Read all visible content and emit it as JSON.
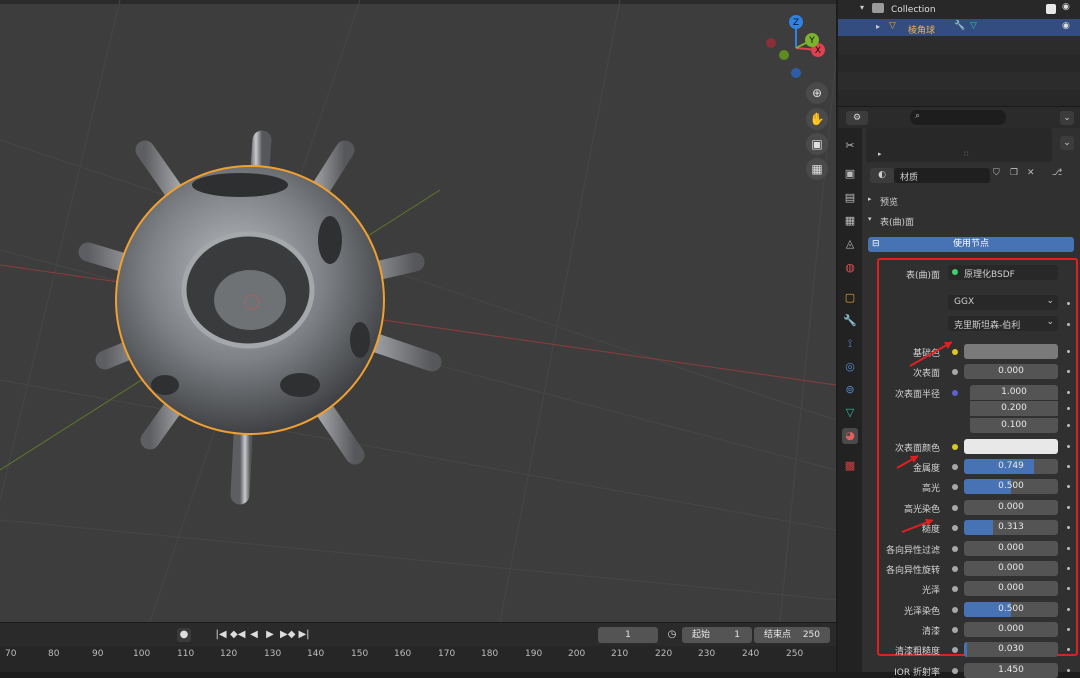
{
  "outliner": {
    "collection_label": "Collection",
    "object_label": "棱角球"
  },
  "properties": {
    "material_name": "材质",
    "preview_label": "预览",
    "surface_label": "表(曲)面",
    "use_nodes_label": "使用节点",
    "surface_shader_label": "表(曲)面",
    "surface_shader_value": "原理化BSDF",
    "distribution": "GGX",
    "subsurface_method": "克里斯坦森-伯利",
    "rows": [
      {
        "label": "基础色",
        "kind": "color",
        "color": "#7a7a7a",
        "socket": "#d8c820"
      },
      {
        "label": "次表面",
        "kind": "value",
        "value": "0.000",
        "fraction": 0
      },
      {
        "label": "次表面半径",
        "kind": "vector",
        "values": [
          "1.000",
          "0.200",
          "0.100"
        ],
        "socket": "#6060d0"
      },
      {
        "label": "次表面颜色",
        "kind": "color",
        "color": "#e8e8e8",
        "socket": "#d8c820"
      },
      {
        "label": "金属度",
        "kind": "value",
        "value": "0.749",
        "fraction": 0.749
      },
      {
        "label": "高光",
        "kind": "value",
        "value": "0.500",
        "fraction": 0.5
      },
      {
        "label": "高光染色",
        "kind": "value",
        "value": "0.000",
        "fraction": 0
      },
      {
        "label": "糙度",
        "kind": "value",
        "value": "0.313",
        "fraction": 0.313
      },
      {
        "label": "各向异性过滤",
        "kind": "value",
        "value": "0.000",
        "fraction": 0
      },
      {
        "label": "各向异性旋转",
        "kind": "value",
        "value": "0.000",
        "fraction": 0
      },
      {
        "label": "光泽",
        "kind": "value",
        "value": "0.000",
        "fraction": 0
      },
      {
        "label": "光泽染色",
        "kind": "value",
        "value": "0.500",
        "fraction": 0.5
      },
      {
        "label": "清漆",
        "kind": "value",
        "value": "0.000",
        "fraction": 0
      },
      {
        "label": "清漆粗糙度",
        "kind": "value",
        "value": "0.030",
        "fraction": 0.03
      },
      {
        "label": "IOR 折射率",
        "kind": "value",
        "value": "1.450",
        "fraction": 0
      }
    ]
  },
  "gizmo": {
    "x": "X",
    "y": "Y",
    "z": "Z"
  },
  "timeline": {
    "current_frame": "1",
    "start_label": "起始",
    "start_value": "1",
    "end_label": "结束点",
    "end_value": "250",
    "ticks": [
      "70",
      "80",
      "90",
      "100",
      "110",
      "120",
      "130",
      "140",
      "150",
      "160",
      "170",
      "180",
      "190",
      "200",
      "210",
      "220",
      "230",
      "240",
      "250"
    ]
  },
  "colors": {
    "accent": "#4772b3",
    "selection_outline": "#f0a030",
    "annotation": "#e02020"
  }
}
